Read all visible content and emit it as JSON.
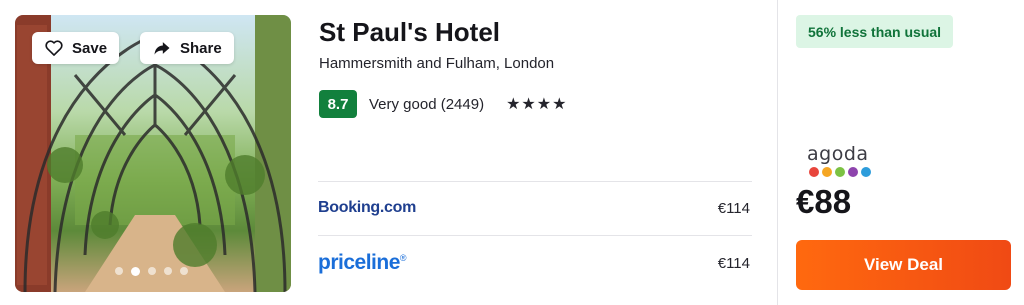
{
  "hotel": {
    "name": "St Paul's Hotel",
    "location": "Hammersmith and Fulham, London",
    "score": "8.7",
    "rating_label": "Very good (2449)",
    "stars": "★★★★",
    "star_count": 4
  },
  "photo": {
    "save_label": "Save",
    "share_label": "Share",
    "carousel": {
      "total": 5,
      "active_index": 1
    }
  },
  "providers": [
    {
      "name": "Booking.com",
      "price": "€114"
    },
    {
      "name": "priceline",
      "registered_mark": "®",
      "price": "€114"
    }
  ],
  "deal": {
    "savings_badge": "56% less than usual",
    "provider": "agoda",
    "provider_dot_colors": [
      "#e8453c",
      "#f5a623",
      "#7cc243",
      "#8e44ad",
      "#2d9cdb"
    ],
    "price": "€88",
    "cta_label": "View Deal"
  },
  "colors": {
    "score_badge": "#12803d",
    "savings_bg": "#dcf5e5",
    "savings_text": "#10733a",
    "cta_start": "#ff690f",
    "cta_end": "#f04a14",
    "booking_blue": "#1f3f8f",
    "priceline_blue": "#1a6ed9"
  }
}
